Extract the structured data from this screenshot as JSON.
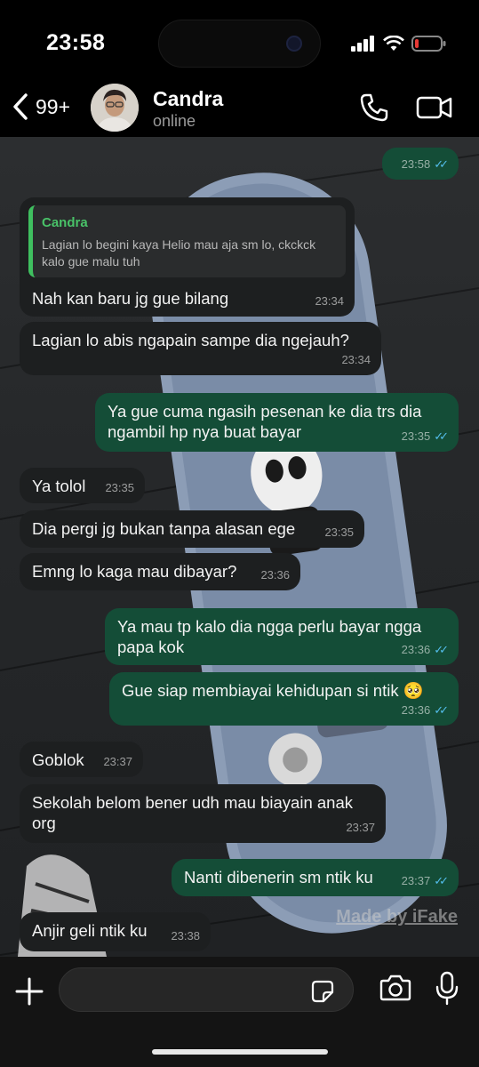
{
  "status_bar": {
    "time": "23:58",
    "battery_level": 0.15
  },
  "header": {
    "back_count": "99+",
    "contact_name": "Candra",
    "contact_status": "online"
  },
  "messages": [
    {
      "dir": "out",
      "text": "",
      "time": "23:58",
      "read": true
    },
    {
      "dir": "in",
      "quote_name": "Candra",
      "quote_text": "Lagian lo begini kaya Helio mau aja sm lo, ckckck kalo gue malu tuh",
      "text": "Nah kan baru jg gue bilang",
      "time": "23:34"
    },
    {
      "dir": "in",
      "text": "Lagian lo abis ngapain sampe dia ngejauh?",
      "time": "23:34"
    },
    {
      "dir": "out",
      "text": "Ya gue cuma ngasih pesenan ke dia trs dia ngambil hp nya buat bayar",
      "time": "23:35",
      "read": true
    },
    {
      "dir": "in",
      "text": "Ya tolol",
      "time": "23:35"
    },
    {
      "dir": "in",
      "text": "Dia pergi jg bukan tanpa alasan ege",
      "time": "23:35"
    },
    {
      "dir": "in",
      "text": "Emng lo kaga mau dibayar?",
      "time": "23:36"
    },
    {
      "dir": "out",
      "text": "Ya mau tp kalo dia ngga perlu bayar ngga papa kok",
      "time": "23:36",
      "read": true
    },
    {
      "dir": "out",
      "text": "Gue siap membiayai kehidupan si ntik 🥺",
      "time": "23:36",
      "read": true
    },
    {
      "dir": "in",
      "text": "Goblok",
      "time": "23:37"
    },
    {
      "dir": "in",
      "text": "Sekolah belom bener udh mau biayain anak org",
      "time": "23:37"
    },
    {
      "dir": "out",
      "text": "Nanti dibenerin sm ntik ku",
      "time": "23:37",
      "read": true
    },
    {
      "dir": "in",
      "text": "Anjir geli ntik ku",
      "time": "23:38"
    }
  ],
  "watermark": "Made by iFake",
  "input": {
    "placeholder": ""
  },
  "icons": {
    "back": "chevron-left-icon",
    "call": "phone-icon",
    "video": "video-camera-icon",
    "plus": "plus-icon",
    "sticker": "sticker-icon",
    "camera": "camera-icon",
    "mic": "microphone-icon"
  },
  "colors": {
    "incoming_bubble": "#1d1f20",
    "outgoing_bubble": "#144d37",
    "read_ticks": "#53bdeb",
    "quote_accent": "#3fbf5f",
    "battery_low": "#e53935"
  }
}
